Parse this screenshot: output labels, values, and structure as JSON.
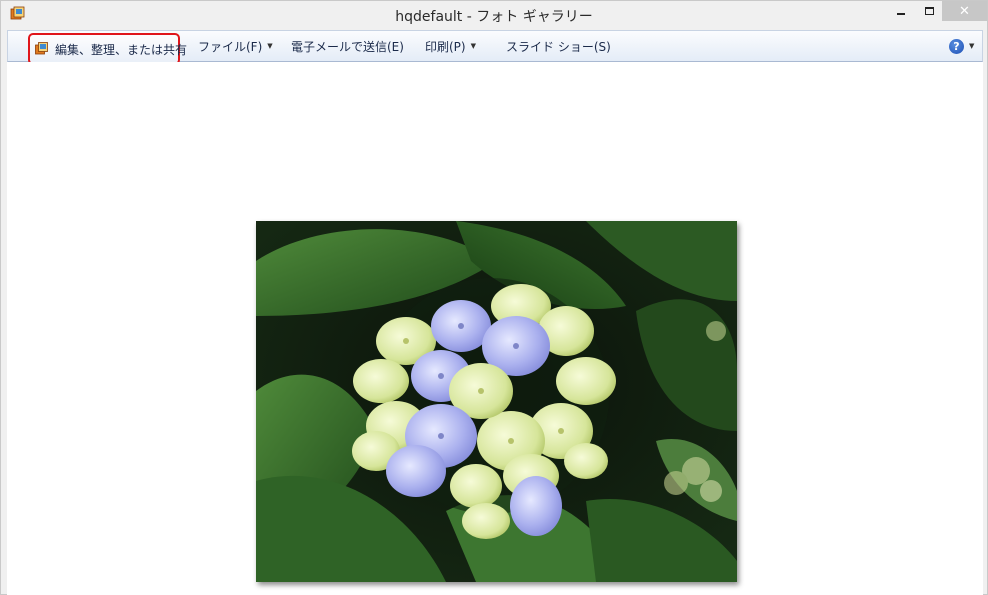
{
  "window": {
    "title": "hqdefault - フォト ギャラリー",
    "controls": {
      "close_glyph": "✕"
    }
  },
  "commandbar": {
    "items": [
      {
        "label": "編集、整理、または共有",
        "icon": "photo-gallery-icon",
        "highlighted": true,
        "highlight_color": "#e0151b"
      },
      {
        "label": "ファイル(F)",
        "dropdown": true
      },
      {
        "label": "電子メールで送信(E)",
        "dropdown": false
      },
      {
        "label": "印刷(P)",
        "dropdown": true
      },
      {
        "label": "スライド ショー(S)",
        "dropdown": false
      }
    ],
    "help": {
      "glyph": "?",
      "icon": "help-icon",
      "dropdown": true
    }
  },
  "viewer": {
    "image": {
      "subject": "hydrangea-photo"
    }
  }
}
